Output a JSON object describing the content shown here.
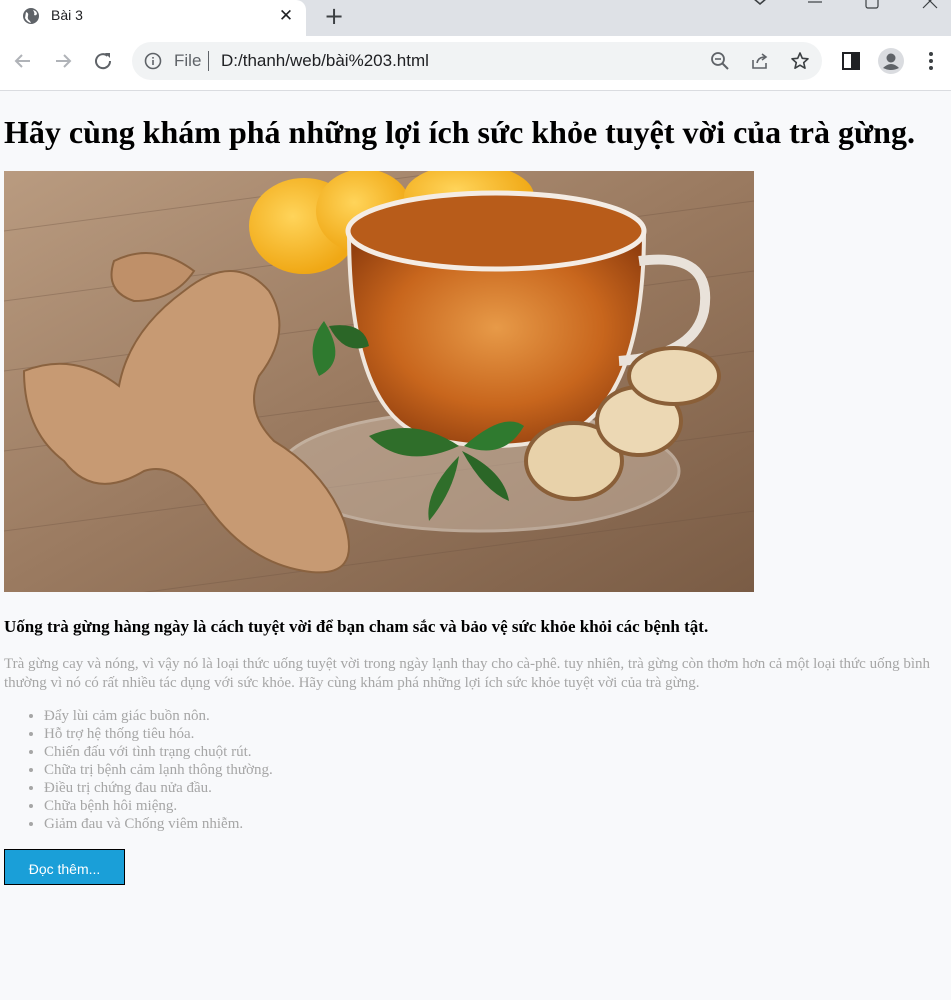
{
  "browser": {
    "tab_title": "Bài 3",
    "url_scheme": "File",
    "url_path": "D:/thanh/web/bài%203.html",
    "icons": [
      "globe-icon",
      "close-icon",
      "plus-icon",
      "back-icon",
      "forward-icon",
      "reload-icon",
      "info-icon",
      "zoom-out-icon",
      "share-icon",
      "star-icon",
      "side-panel-icon",
      "profile-icon",
      "more-icon"
    ]
  },
  "page": {
    "title": "Hãy cùng khám phá những lợi ích sức khỏe tuyệt vời của trà gừng.",
    "subheading": "Uống trà gừng hàng ngày là cách tuyệt vời để bạn cham sắc và bảo vệ sức khỏe khỏi các bệnh tật.",
    "intro": "Trà gừng cay và nóng, vì vậy nó là loại thức uống tuyệt vời trong ngày lạnh thay cho cà-phê. tuy nhiên, trà gừng còn thơm hơn cả một loại thức uống bình thường vì nó có rất nhiều tác dụng với sức khỏe. Hãy cùng khám phá những lợi ích sức khỏe tuyệt vời của trà gừng.",
    "benefits": [
      "Đẩy lùi cảm giác buồn nôn.",
      "Hỗ trợ hệ thống tiêu hóa.",
      "Chiến đấu với tình trạng chuột rút.",
      "Chữa trị bệnh cảm lạnh thông thường.",
      "Điều trị chứng đau nửa đầu.",
      "Chữa bệnh hôi miệng.",
      "Giảm đau và Chống viêm nhiễm."
    ],
    "read_more": "Đọc thêm...",
    "colors": {
      "button": "#1a9fd8",
      "muted_text": "#a6a6a6",
      "background": "#f8f9fb"
    }
  }
}
